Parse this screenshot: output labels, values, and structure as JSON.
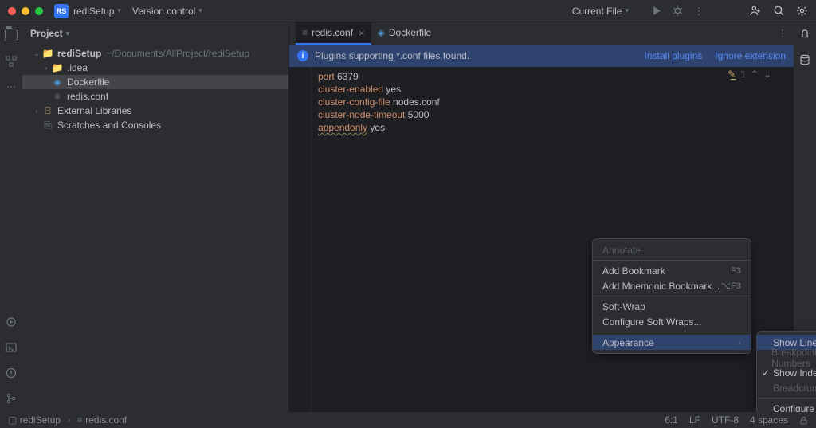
{
  "titlebar": {
    "project_badge": "RS",
    "project_name": "rediSetup",
    "version_control": "Version control",
    "run_config": "Current File"
  },
  "sidebar": {
    "title": "Project",
    "tree": {
      "root_name": "rediSetup",
      "root_path": "~/Documents/AllProject/rediSetup",
      "idea": ".idea",
      "dockerfile": "Dockerfile",
      "redis_conf": "redis.conf",
      "ext_libs": "External Libraries",
      "scratches": "Scratches and Consoles"
    }
  },
  "tabs": {
    "redis_conf": "redis.conf",
    "dockerfile": "Dockerfile"
  },
  "banner": {
    "text": "Plugins supporting *.conf files found.",
    "install": "Install plugins",
    "ignore": "Ignore extension"
  },
  "code": {
    "l1a": "port",
    "l1b": " 6379",
    "l2a": "cluster-enabled",
    "l2b": " yes",
    "l3a": "cluster-config-file",
    "l3b": " nodes.conf",
    "l4a": "cluster-node-timeout",
    "l4b": " 5000",
    "l5a": "appendonly",
    "l5b": " yes"
  },
  "inspection": {
    "count": "1"
  },
  "context_menu_1": {
    "annotate": "Annotate",
    "add_bookmark": "Add Bookmark",
    "bm_sc": "F3",
    "add_mnemonic": "Add Mnemonic Bookmark...",
    "mn_sc": "⌥F3",
    "soft_wrap": "Soft-Wrap",
    "config_wraps": "Configure Soft Wraps...",
    "appearance": "Appearance"
  },
  "context_menu_2": {
    "line_numbers": "Show Line Numbers",
    "breakpoints_over": "Breakpoints Over Line Numbers",
    "indent_guides": "Show Indent Guides",
    "breadcrumbs": "Breadcrumbs",
    "gutter_icons": "Configure Gutter Icons..."
  },
  "status": {
    "crumb_root": "rediSetup",
    "crumb_file": "redis.conf",
    "caret": "6:1",
    "line_sep": "LF",
    "encoding": "UTF-8",
    "indent": "4 spaces"
  }
}
